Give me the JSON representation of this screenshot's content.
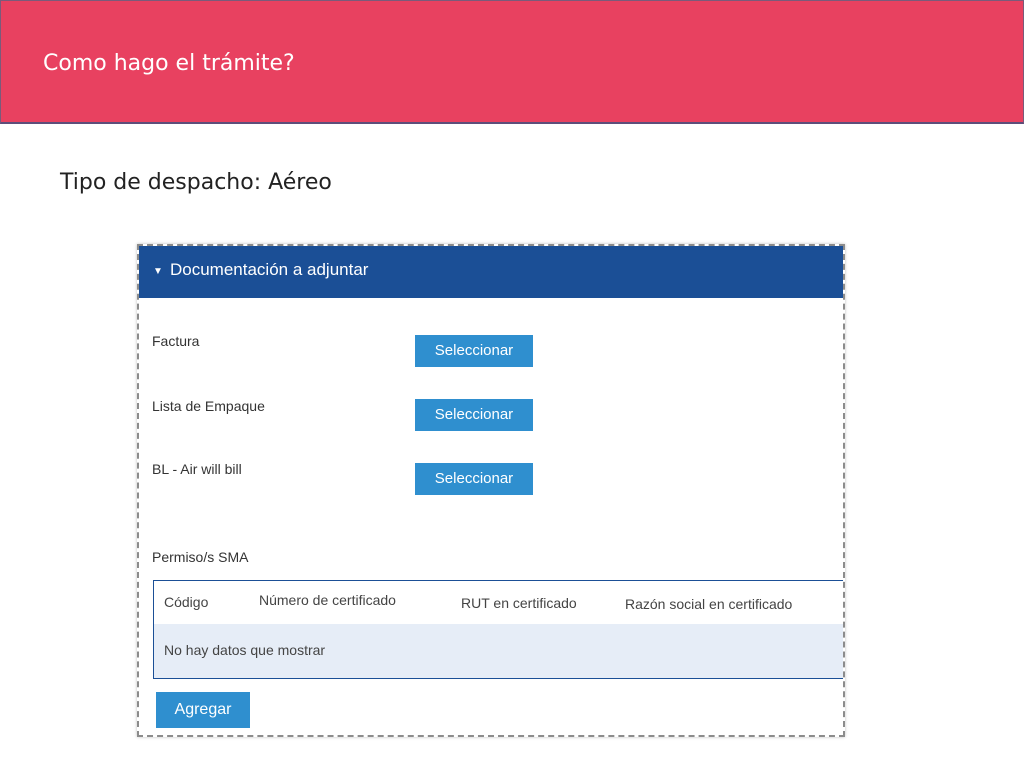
{
  "slide": {
    "title": "Como hago el trámite?",
    "subtitle": "Tipo de despacho: Aéreo"
  },
  "panel": {
    "caret": "▼",
    "title": "Documentación a adjuntar",
    "documents": [
      {
        "label": "Factura",
        "button": "Seleccionar"
      },
      {
        "label": "Lista de Empaque",
        "button": "Seleccionar"
      },
      {
        "label": "BL - Air will bill",
        "button": "Seleccionar"
      }
    ],
    "permits": {
      "label": "Permiso/s SMA",
      "columns": [
        "Código",
        "Número de certificado",
        "RUT en certificado",
        "Razón social en certificado"
      ],
      "empty_message": "No hay datos que mostrar",
      "add_button": "Agregar"
    }
  },
  "colors": {
    "header_bg": "#e84160",
    "panel_header_bg": "#1b4f96",
    "button_bg": "#2f8fcf",
    "empty_row_bg": "#e6edf7"
  }
}
